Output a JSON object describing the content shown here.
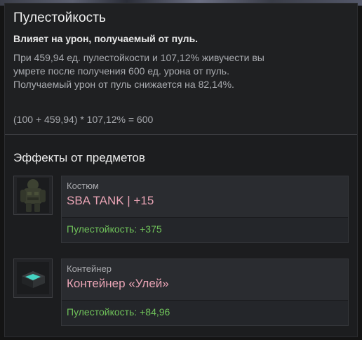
{
  "tooltip": {
    "title": "Пулестойкость",
    "subtitle": "Влияет на урон, получаемый от пуль.",
    "description_lines": [
      "При 459,94 ед. пулестойкости и 107,12% живучести вы",
      "умрете после получения 600 ед. урона от пуль.",
      "Получаемый урон от пуль снижается на 82,14%."
    ],
    "formula": "(100 + 459,94) * 107,12% = 600"
  },
  "effects": {
    "title": "Эффекты от предметов",
    "items": [
      {
        "category": "Костюм",
        "name": "SBA TANK | +15",
        "effect": "Пулестойкость: +375",
        "icon": "suit-icon"
      },
      {
        "category": "Контейнер",
        "name": "Контейнер «Улей»",
        "effect": "Пулестойкость: +84,96",
        "icon": "container-icon"
      }
    ]
  },
  "colors": {
    "item_name": "#e8a3b4",
    "effect_positive": "#6fc15a",
    "panel_bg": "#1c1d1f"
  }
}
